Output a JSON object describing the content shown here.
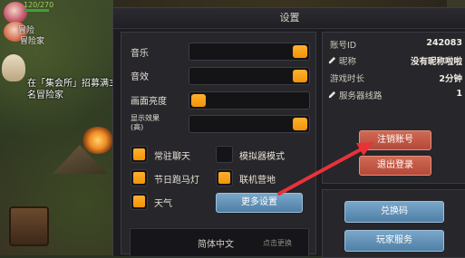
{
  "hud": {
    "hp_text": "120/270",
    "name1": "冒险",
    "name2": "冒险家",
    "quest_text": "在「集会所」招募满3名冒险家"
  },
  "dialog": {
    "title": "设置",
    "settings": {
      "music_label": "音乐",
      "music_level": 1.0,
      "sfx_label": "音效",
      "sfx_level": 1.0,
      "brightness_label": "画面亮度",
      "brightness_level": 0.0,
      "display_effect_label_line1": "显示效果",
      "display_effect_label_line2": "(高)",
      "display_effect_level": 1.0,
      "toggles": [
        {
          "label": "常驻聊天",
          "checked": true
        },
        {
          "label": "模拟器模式",
          "checked": false
        },
        {
          "label": "节日跑马灯",
          "checked": true
        },
        {
          "label": "联机营地",
          "checked": true
        },
        {
          "label": "天气",
          "checked": true
        }
      ],
      "more_button": "更多设置",
      "language_value": "简体中文",
      "language_hint": "点击更换"
    },
    "account": {
      "id_label": "账号ID",
      "id_value": "242083",
      "nickname_label": "昵称",
      "nickname_value": "没有昵称啦啦",
      "playtime_label": "游戏时长",
      "playtime_value": "2分钟",
      "server_label": "服务器线路",
      "server_value": "1",
      "cancel_account_button": "注销账号",
      "logout_button": "退出登录",
      "redeem_button": "兑换码",
      "player_service_button": "玩家服务"
    }
  },
  "icons": {
    "pencil": "pencil-icon",
    "arrow": "red-annotation-arrow"
  },
  "colors": {
    "accent_orange": "#f29406",
    "button_blue": "#5f8db3",
    "button_red": "#c15a44",
    "arrow_red": "#e8323a"
  }
}
